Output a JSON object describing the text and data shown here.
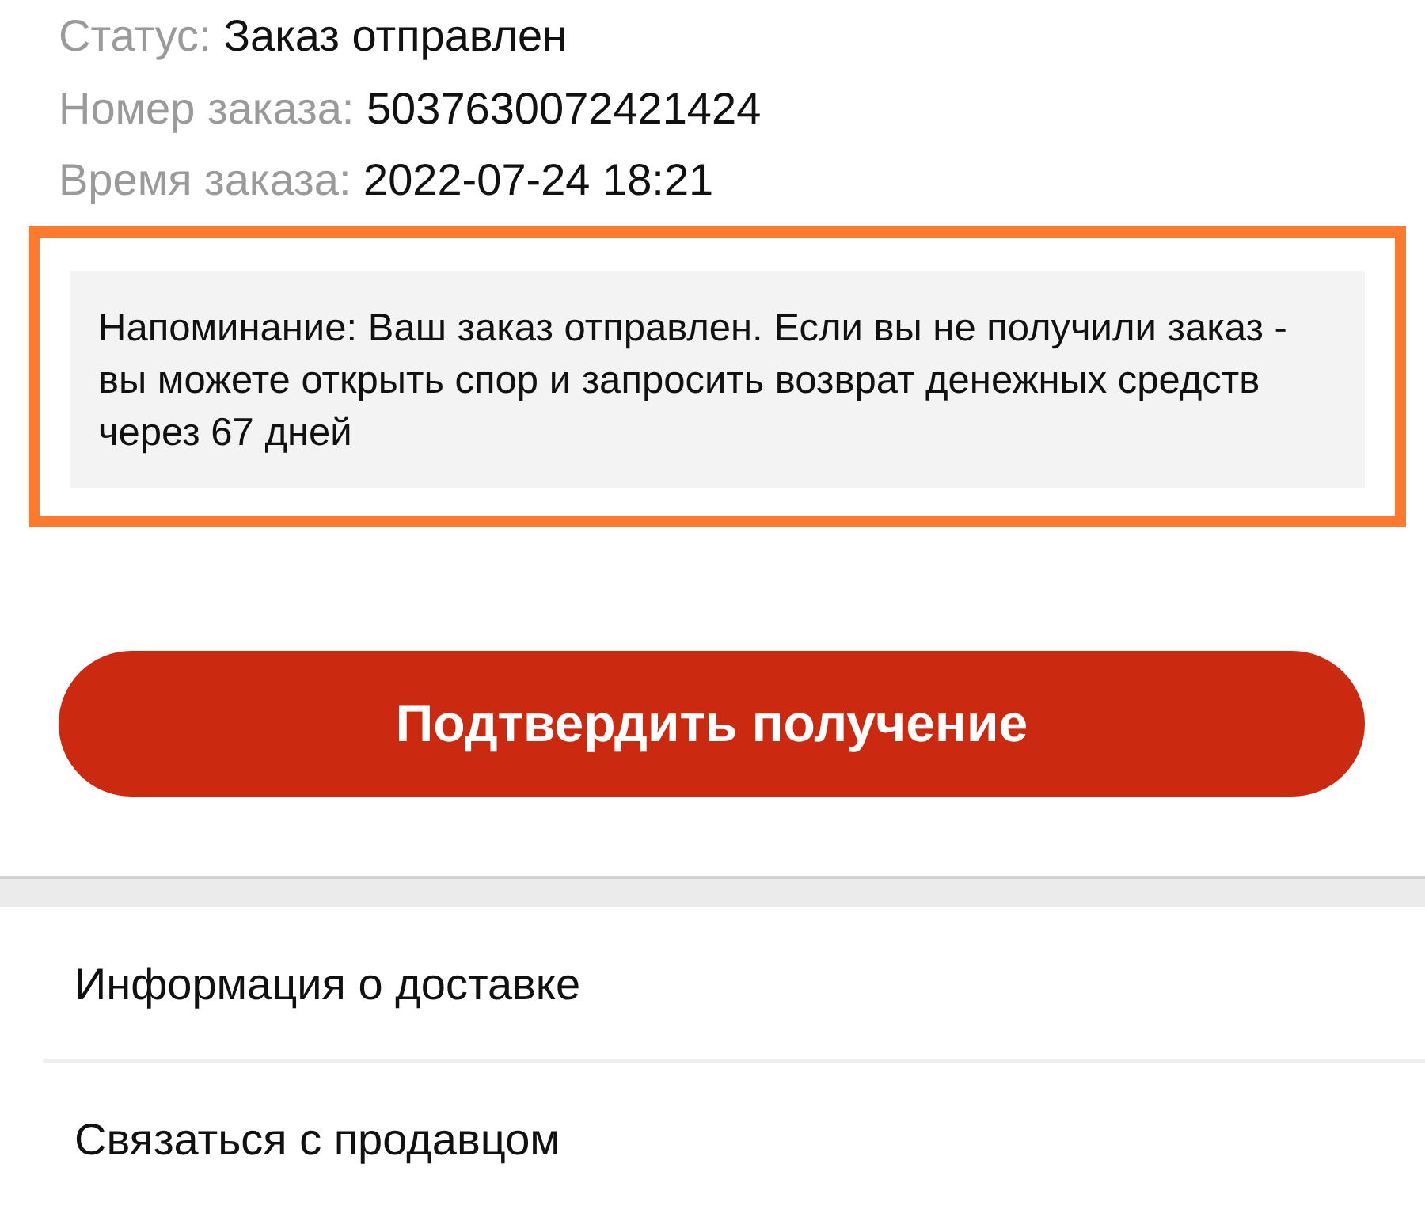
{
  "order_info": [
    {
      "label": "Статус:",
      "value": "Заказ отправлен"
    },
    {
      "label": "Номер заказа:",
      "value": "5037630072421424"
    },
    {
      "label": "Время заказа:",
      "value": "2022-07-24 18:21"
    }
  ],
  "reminder": {
    "highlighted": true,
    "text": "Напоминание: Ваш заказ отправлен. Если вы не получили заказ - вы можете открыть спор и запросить возврат денежных средств через 67 дней"
  },
  "confirm_button": {
    "label": "Подтвердить получение"
  },
  "menu_items": [
    {
      "label": "Информация о доставке"
    },
    {
      "label": "Связаться с продавцом"
    }
  ]
}
